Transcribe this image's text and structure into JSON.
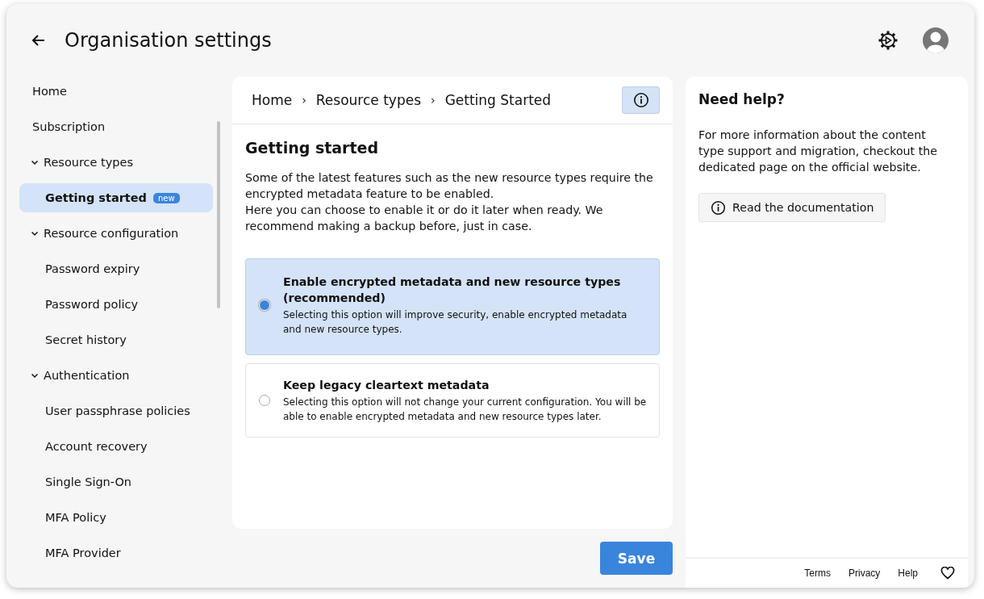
{
  "header": {
    "title": "Organisation settings"
  },
  "sidebar": {
    "items": [
      {
        "label": "Home",
        "selected": false
      },
      {
        "label": "Subscription",
        "selected": false
      },
      {
        "label": "Resource types",
        "selected": false,
        "expanded": true,
        "children": [
          {
            "label": "Getting started",
            "badge": "new",
            "selected": true
          }
        ]
      },
      {
        "label": "Resource configuration",
        "selected": false,
        "expanded": true,
        "children": [
          {
            "label": "Password expiry",
            "selected": false
          },
          {
            "label": "Password policy",
            "selected": false
          },
          {
            "label": "Secret history",
            "selected": false
          }
        ]
      },
      {
        "label": "Authentication",
        "selected": false,
        "expanded": true,
        "children": [
          {
            "label": "User passphrase policies",
            "selected": false
          },
          {
            "label": "Account recovery",
            "selected": false
          },
          {
            "label": "Single Sign-On",
            "selected": false
          },
          {
            "label": "MFA Policy",
            "selected": false
          },
          {
            "label": "MFA Provider",
            "selected": false
          }
        ]
      }
    ]
  },
  "breadcrumb": {
    "separator": "›",
    "items": [
      "Home",
      "Resource types",
      "Getting Started"
    ]
  },
  "content": {
    "title": "Getting started",
    "paragraphs": [
      "Some of the latest features such as the new resource types require the encrypted metadata feature to be enabled.",
      "Here you can choose to enable it or do it later when ready. We recommend making a backup before, just in case."
    ],
    "options": [
      {
        "title": "Enable encrypted metadata and new resource types (recommended)",
        "description": "Selecting this option will improve security, enable encrypted metadata and new resource types.",
        "selected": true
      },
      {
        "title": "Keep legacy cleartext metadata",
        "description": "Selecting this option will not change your current configuration. You will be able to enable encrypted metadata and new resource types later.",
        "selected": false
      }
    ]
  },
  "save_button": "Save",
  "help": {
    "title": "Need help?",
    "text": "For more information about the content type support and migration, checkout the dedicated page on the official website.",
    "button": "Read the documentation"
  },
  "footer": {
    "links": [
      "Terms",
      "Privacy",
      "Help"
    ]
  }
}
